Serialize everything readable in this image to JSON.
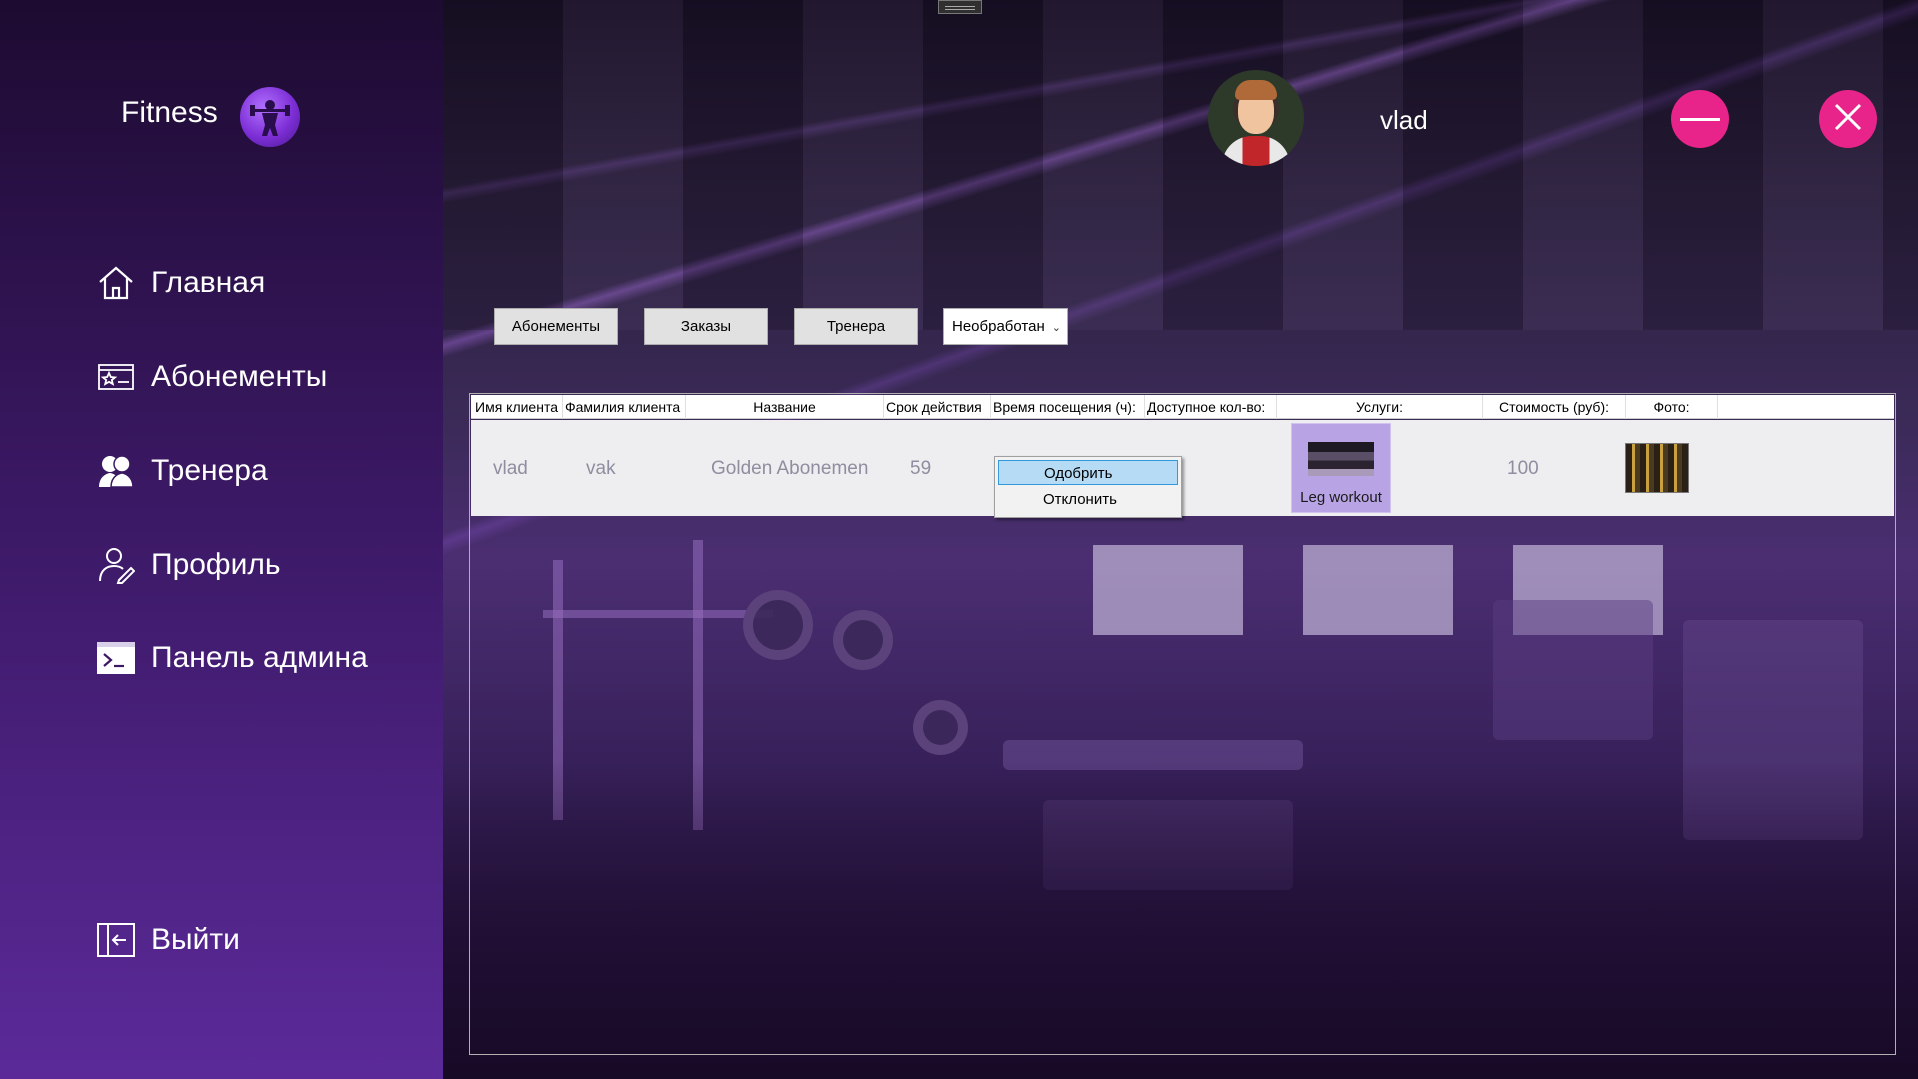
{
  "app": {
    "brand": "Fitness"
  },
  "sidebar": {
    "items": [
      {
        "label": "Главная",
        "icon": "home-icon"
      },
      {
        "label": "Абонементы",
        "icon": "subscription-card-icon"
      },
      {
        "label": "Тренера",
        "icon": "trainers-icon"
      },
      {
        "label": "Профиль",
        "icon": "profile-icon"
      },
      {
        "label": "Панель админа",
        "icon": "terminal-icon"
      }
    ],
    "logout": {
      "label": "Выйти",
      "icon": "logout-icon"
    }
  },
  "header": {
    "username": "vlad",
    "minimize_icon": "minus-icon",
    "close_icon": "close-icon",
    "accent_color": "#e8248a"
  },
  "toolbar": {
    "subscriptions_label": "Абонементы",
    "orders_label": "Заказы",
    "trainers_label": "Тренера",
    "status_filter": {
      "selected": "Необработан"
    }
  },
  "grid": {
    "columns": [
      "Имя клиента",
      "Фамилия клиента",
      "Название",
      "Срок действия",
      "Время посещения (ч):",
      "Доступное кол-во:",
      "Услуги:",
      "Стоимость (руб):",
      "Фото:"
    ],
    "rows": [
      {
        "first_name": "vlad",
        "last_name": "vak",
        "name": "Golden Abonemen",
        "duration": "59",
        "service": "Leg workout",
        "price": "100"
      }
    ]
  },
  "context_menu": {
    "items": [
      "Одобрить",
      "Отклонить"
    ]
  }
}
